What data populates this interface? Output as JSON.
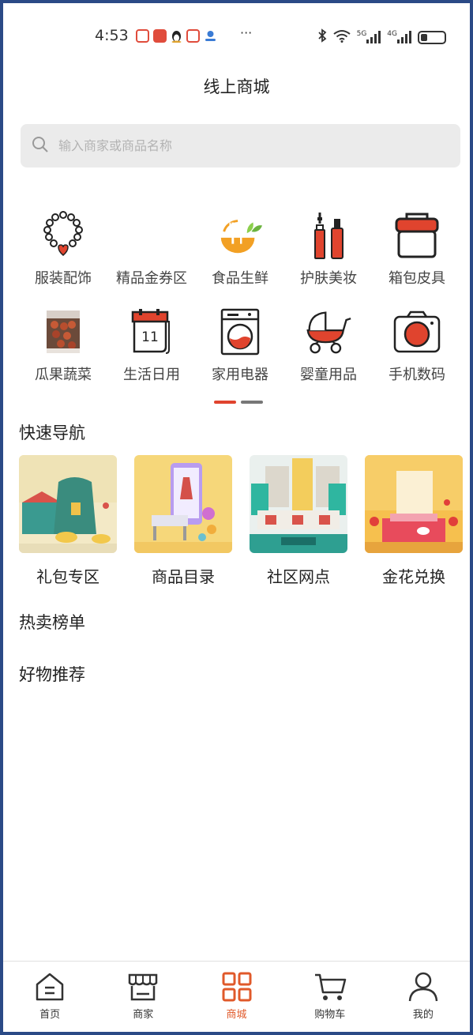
{
  "status_bar": {
    "time": "4:53",
    "more": "···",
    "net1": "5G",
    "net2": "4G"
  },
  "header": {
    "title": "线上商城"
  },
  "search": {
    "placeholder": "输入商家或商品名称"
  },
  "categories": [
    {
      "label": "服装配饰",
      "icon": "necklace-icon"
    },
    {
      "label": "精品金券区",
      "icon": "blank-icon"
    },
    {
      "label": "食品生鲜",
      "icon": "fork-spoon-icon"
    },
    {
      "label": "护肤美妆",
      "icon": "cosmetics-icon"
    },
    {
      "label": "箱包皮具",
      "icon": "bag-icon"
    },
    {
      "label": "瓜果蔬菜",
      "icon": "fruit-photo-icon"
    },
    {
      "label": "生活日用",
      "icon": "calendar-icon"
    },
    {
      "label": "家用电器",
      "icon": "washing-machine-icon"
    },
    {
      "label": "婴童用品",
      "icon": "stroller-icon"
    },
    {
      "label": "手机数码",
      "icon": "camera-icon"
    }
  ],
  "calendar_day": "11",
  "sections": {
    "quick_nav": "快速导航",
    "hot_list": "热卖榜单",
    "recommend": "好物推荐"
  },
  "quick_nav": [
    {
      "label": "礼包专区"
    },
    {
      "label": "商品目录"
    },
    {
      "label": "社区网点"
    },
    {
      "label": "金花兑换"
    }
  ],
  "tabbar": [
    {
      "label": "首页",
      "icon": "home-icon"
    },
    {
      "label": "商家",
      "icon": "store-icon"
    },
    {
      "label": "商城",
      "icon": "grid-icon",
      "active": true
    },
    {
      "label": "购物车",
      "icon": "cart-icon"
    },
    {
      "label": "我的",
      "icon": "user-icon"
    }
  ],
  "colors": {
    "accent": "#e0442e",
    "tab_active": "#e0592a",
    "search_bg": "#ebebeb"
  },
  "battery_level": 0.3
}
